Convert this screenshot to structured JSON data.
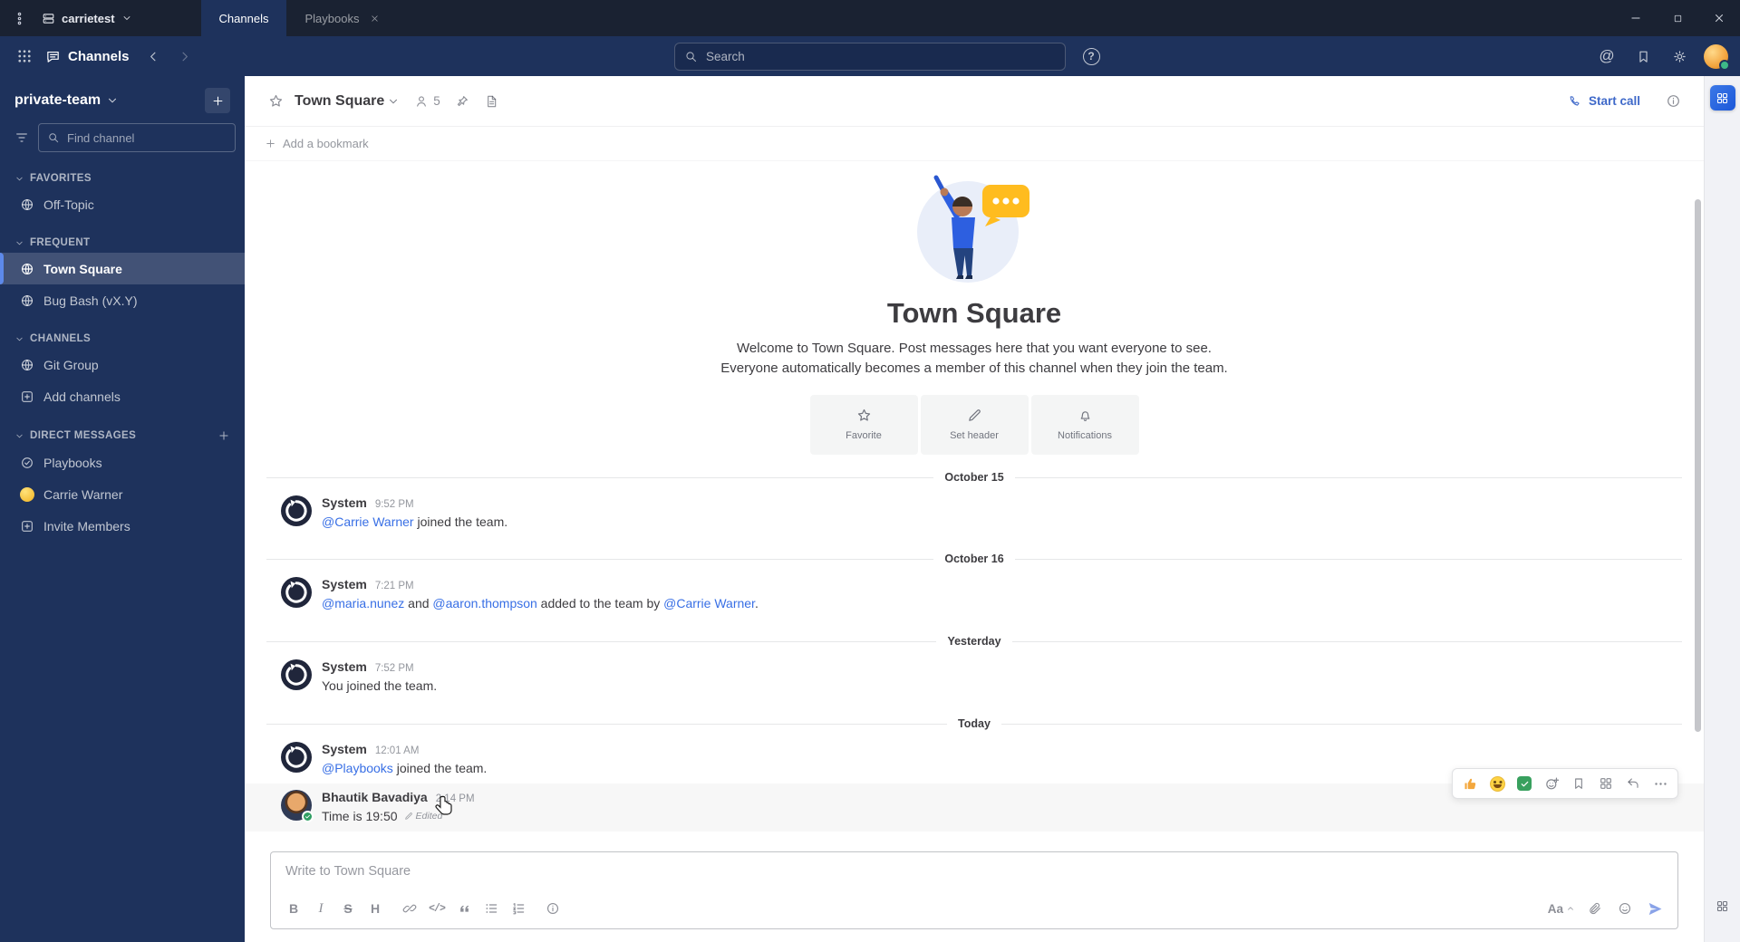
{
  "titlebar": {
    "server_name": "carrietest",
    "tabs": [
      {
        "label": "Channels"
      },
      {
        "label": "Playbooks"
      }
    ]
  },
  "header": {
    "product": "Channels",
    "search_placeholder": "Search"
  },
  "sidebar": {
    "team_name": "private-team",
    "find_placeholder": "Find channel",
    "sections": {
      "favorites": {
        "title": "FAVORITES",
        "items": [
          {
            "label": "Off-Topic"
          }
        ]
      },
      "frequent": {
        "title": "FREQUENT",
        "items": [
          {
            "label": "Town Square"
          },
          {
            "label": "Bug Bash (vX.Y)"
          }
        ]
      },
      "channels": {
        "title": "CHANNELS",
        "items": [
          {
            "label": "Git Group"
          },
          {
            "label": "Add channels"
          }
        ]
      },
      "dm": {
        "title": "DIRECT MESSAGES",
        "items": [
          {
            "label": "Playbooks"
          },
          {
            "label": "Carrie Warner"
          },
          {
            "label": "Invite Members"
          }
        ]
      }
    }
  },
  "channel": {
    "title": "Town Square",
    "member_count": "5",
    "start_call": "Start call",
    "add_bookmark": "Add a bookmark"
  },
  "intro": {
    "title": "Town Square",
    "description": "Welcome to Town Square. Post messages here that you want everyone to see. Everyone automatically becomes a member of this channel when they join the team.",
    "actions": [
      {
        "label": "Favorite"
      },
      {
        "label": "Set header"
      },
      {
        "label": "Notifications"
      }
    ]
  },
  "dividers": [
    "October 15",
    "October 16",
    "Yesterday",
    "Today"
  ],
  "messages": [
    {
      "author": "System",
      "time": "9:52 PM",
      "parts": [
        {
          "text": "@Carrie Warner"
        },
        {
          "text": " joined the team."
        }
      ]
    },
    {
      "author": "System",
      "time": "7:21 PM",
      "parts": [
        {
          "text": "@maria.nunez"
        },
        {
          "text": " and "
        },
        {
          "text": "@aaron.thompson"
        },
        {
          "text": " added to the team by "
        },
        {
          "text": "@Carrie Warner"
        },
        {
          "text": "."
        }
      ]
    },
    {
      "author": "System",
      "time": "7:52 PM",
      "parts": [
        {
          "text": "You joined the team."
        }
      ]
    },
    {
      "author": "System",
      "time": "12:01 AM",
      "parts": [
        {
          "text": "@Playbooks"
        },
        {
          "text": " joined the team."
        }
      ]
    },
    {
      "author": "Bhautik Bavadiya",
      "time": "2:14 PM",
      "parts": [
        {
          "text": "Time is 19:50"
        }
      ],
      "edited": "Edited"
    }
  ],
  "composer": {
    "placeholder": "Write to Town Square",
    "formatting_label": "Aa",
    "toolbar": {
      "bold": "B",
      "italic": "I",
      "strike": "S",
      "heading": "H",
      "code": "</>"
    }
  },
  "icons": {
    "at": "@",
    "help": "?"
  },
  "colors": {
    "accent": "#1c58d9",
    "sidebar": "#1e325c",
    "link": "#386fe5",
    "online": "#3db887",
    "active_border": "#5d89ea"
  }
}
